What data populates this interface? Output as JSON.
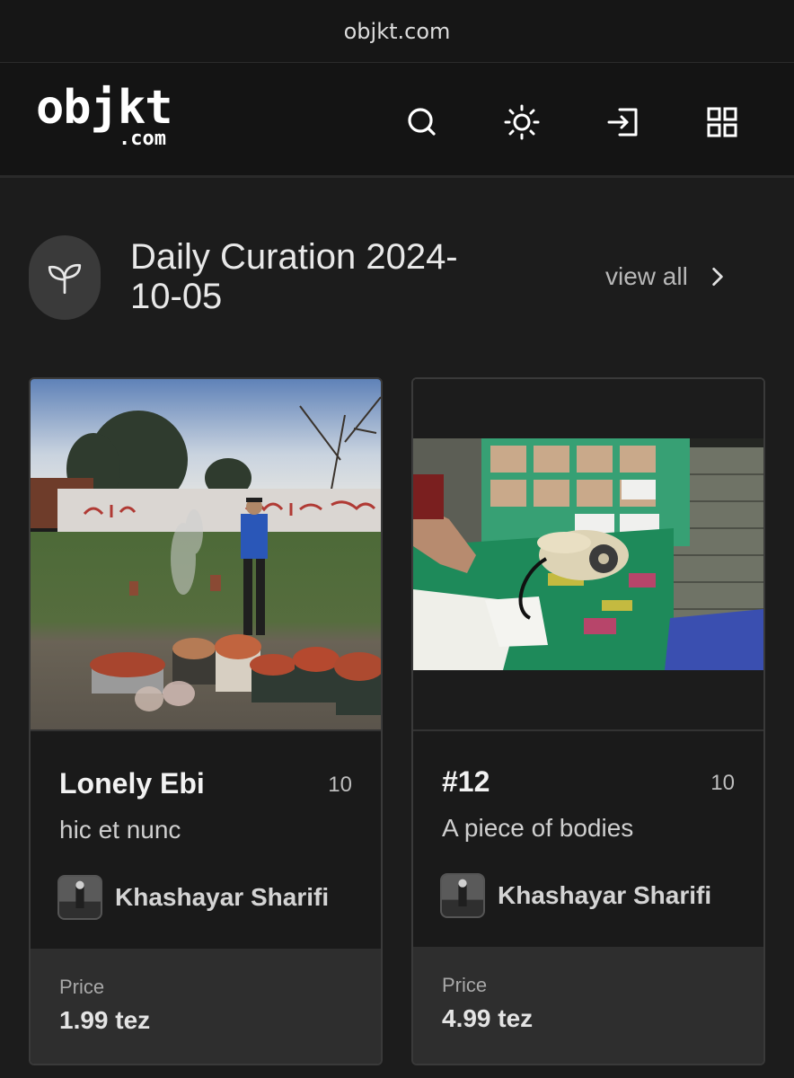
{
  "browser": {
    "url": "objkt.com"
  },
  "header": {
    "logo_main": "objkt",
    "logo_sub": ".com",
    "icons": [
      "search-icon",
      "theme-sun-icon",
      "sign-in-icon",
      "apps-grid-icon"
    ]
  },
  "curation": {
    "title": "Daily Curation 2024-10-05",
    "view_all": "view all"
  },
  "cards": [
    {
      "title": "Lonely Ebi",
      "editions": "10",
      "platform": "hic et nunc",
      "artist": "Khashayar Sharifi",
      "price_label": "Price",
      "price": "1.99 tez"
    },
    {
      "title": "#12",
      "editions": "10",
      "platform": "A piece of bodies",
      "artist": "Khashayar Sharifi",
      "price_label": "Price",
      "price": "4.99 tez"
    }
  ],
  "colors": {
    "background": "#1c1c1c",
    "header": "#141414",
    "card_price_bg": "#2e2e2e",
    "text": "#e6e6e6"
  }
}
